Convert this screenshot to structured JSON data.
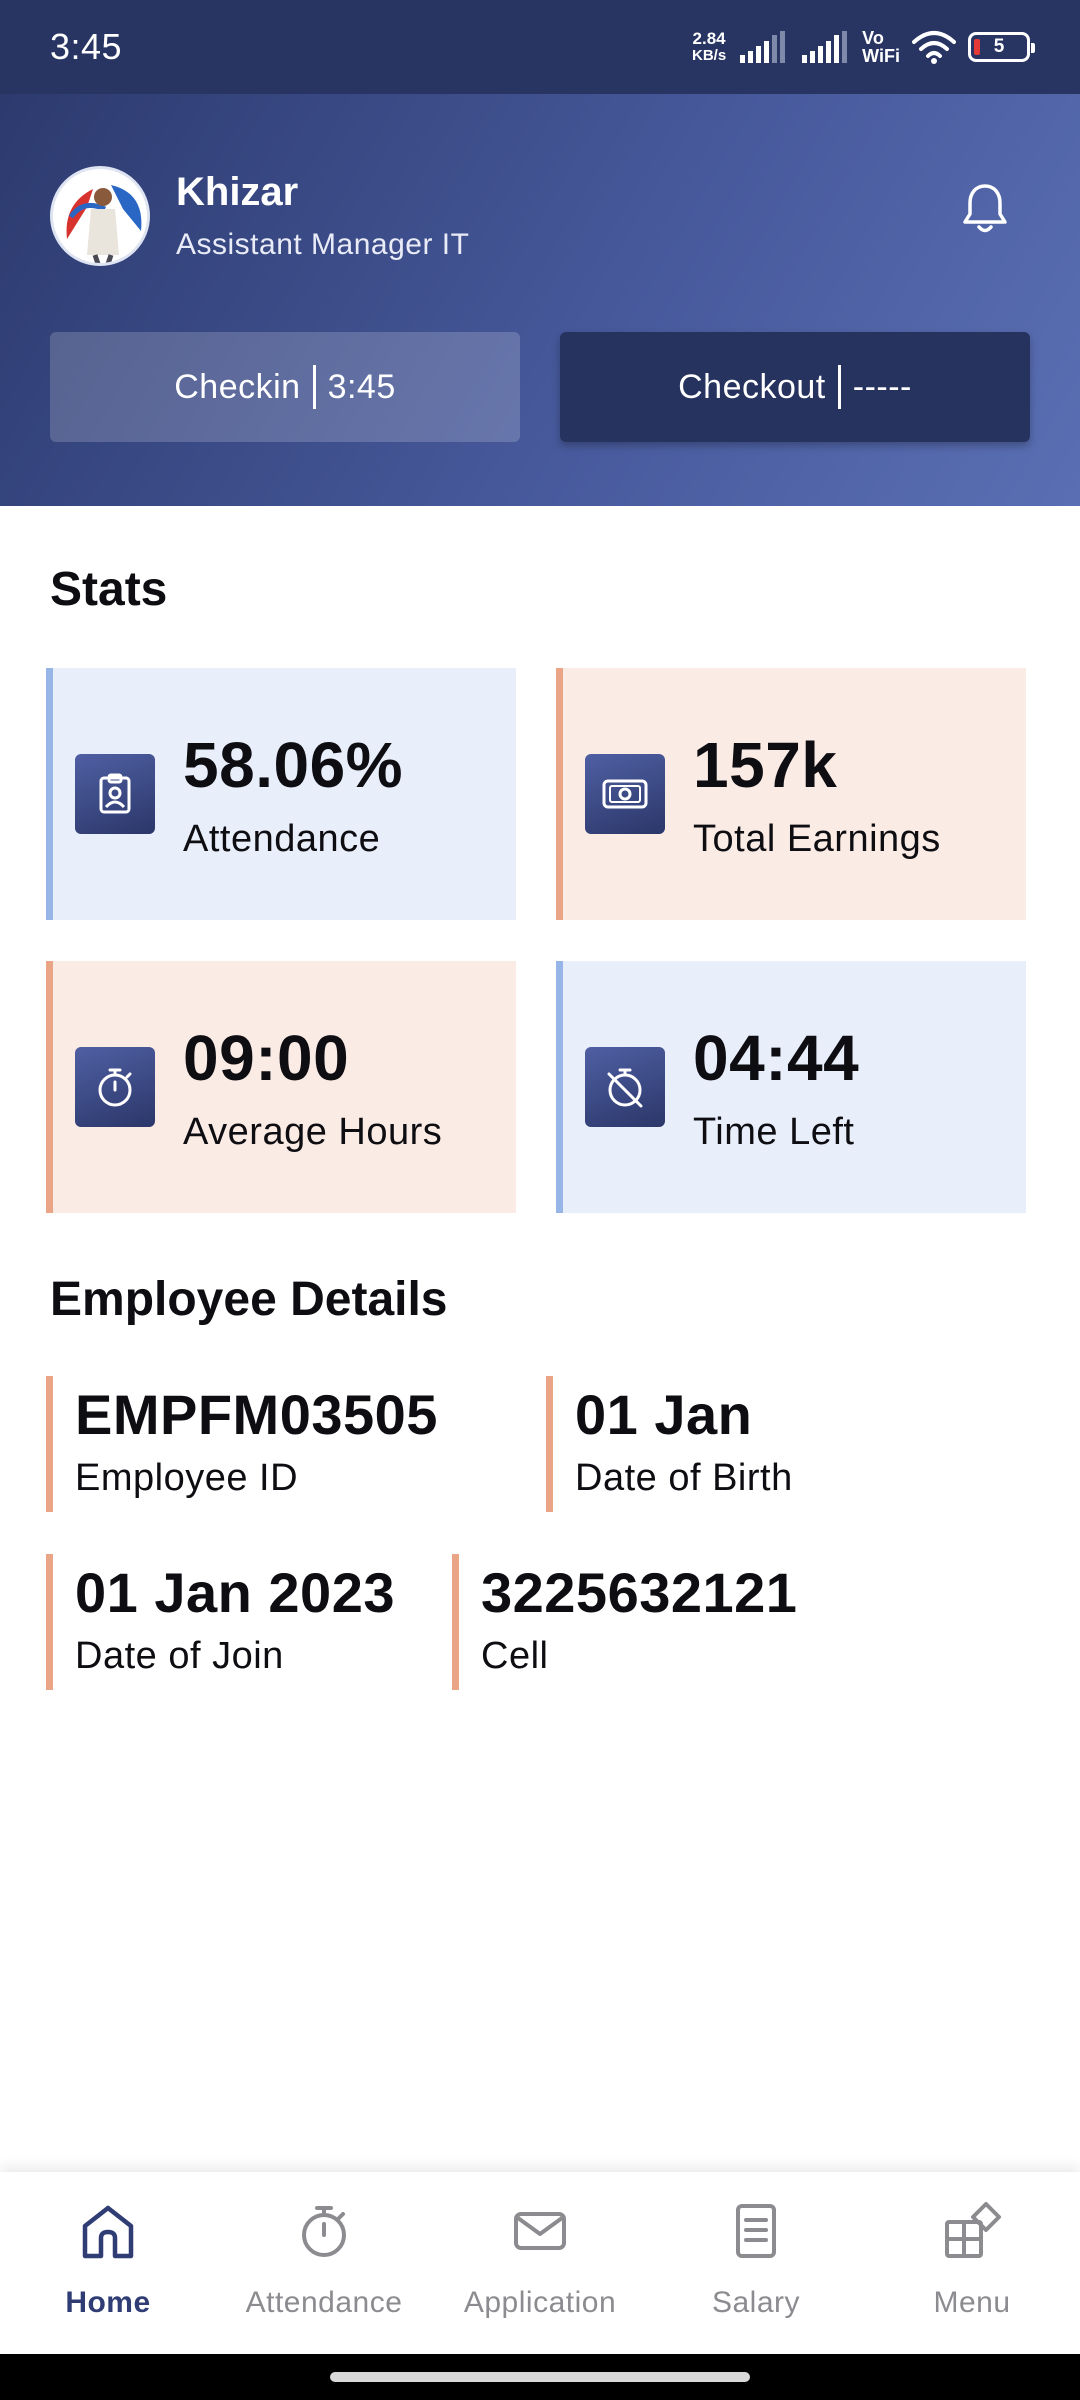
{
  "status_bar": {
    "time": "3:45",
    "net_speed_value": "2.84",
    "net_speed_unit": "KB/s",
    "vowifi_top": "Vo",
    "vowifi_bottom": "WiFi",
    "battery_level": "5"
  },
  "header": {
    "user_name": "Khizar",
    "user_role": "Assistant Manager IT",
    "checkin_label": "Checkin",
    "checkin_time": "3:45",
    "checkout_label": "Checkout",
    "checkout_time": "-----"
  },
  "stats": {
    "title": "Stats",
    "cards": [
      {
        "value": "58.06%",
        "label": "Attendance",
        "icon": "clipboard-badge-icon",
        "tone": "blue"
      },
      {
        "value": "157k",
        "label": "Total Earnings",
        "icon": "cash-icon",
        "tone": "peach"
      },
      {
        "value": "09:00",
        "label": "Average Hours",
        "icon": "stopwatch-icon",
        "tone": "peach"
      },
      {
        "value": "04:44",
        "label": "Time Left",
        "icon": "timer-off-icon",
        "tone": "blue"
      }
    ]
  },
  "employee_details": {
    "title": "Employee Details",
    "items": [
      {
        "value": "EMPFM03505",
        "label": "Employee ID"
      },
      {
        "value": "01 Jan",
        "label": "Date of Birth"
      },
      {
        "value": "01 Jan 2023",
        "label": "Date of Join"
      },
      {
        "value": "3225632121",
        "label": "Cell"
      }
    ]
  },
  "bottom_nav": {
    "items": [
      {
        "label": "Home",
        "icon": "home-icon",
        "active": true
      },
      {
        "label": "Attendance",
        "icon": "stopwatch-icon",
        "active": false
      },
      {
        "label": "Application",
        "icon": "mail-icon",
        "active": false
      },
      {
        "label": "Salary",
        "icon": "document-icon",
        "active": false
      },
      {
        "label": "Menu",
        "icon": "grid-menu-icon",
        "active": false
      }
    ]
  },
  "colors": {
    "header_dark": "#2c3a6e",
    "header_light": "#5a6fb3",
    "card_blue": "#e8eefa",
    "card_peach": "#fbebe5",
    "accent_blue": "#97b5e6",
    "accent_peach": "#e9a585",
    "nav_active": "#2f3d74"
  }
}
